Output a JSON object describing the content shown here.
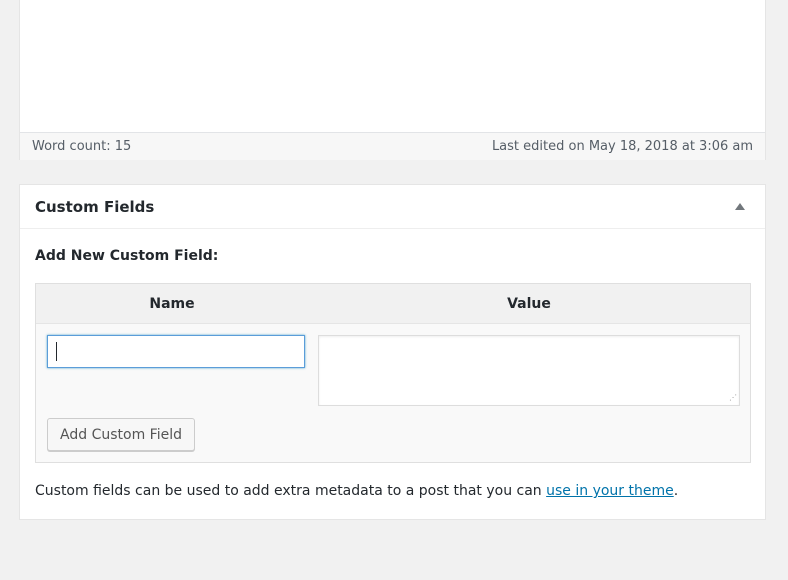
{
  "status_bar": {
    "word_count": "Word count: 15",
    "last_edited": "Last edited on May 18, 2018 at 3:06 am"
  },
  "custom_fields": {
    "title": "Custom Fields",
    "toggle_icon": "triangle-up-icon",
    "add_new_label": "Add New Custom Field:",
    "columns": {
      "name": "Name",
      "value": "Value"
    },
    "name_value": "",
    "value_value": "",
    "add_button_label": "Add Custom Field",
    "help_text_before": "Custom fields can be used to add extra metadata to a post that you can ",
    "help_link_text": "use in your theme",
    "help_text_after": "."
  },
  "colors": {
    "background": "#f1f1f1",
    "link": "#0073aa",
    "focus_border": "#5b9dd9"
  }
}
